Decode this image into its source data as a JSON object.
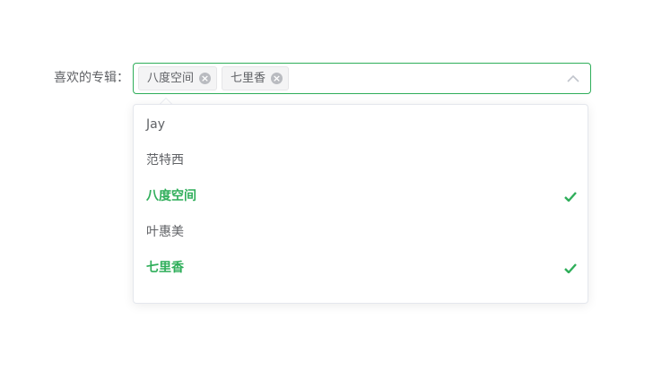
{
  "form": {
    "label": "喜欢的专辑："
  },
  "select": {
    "tags": [
      {
        "label": "八度空间"
      },
      {
        "label": "七里香"
      }
    ],
    "accent_color": "#2fae5a"
  },
  "dropdown": {
    "options": [
      {
        "label": "Jay",
        "selected": false
      },
      {
        "label": "范特西",
        "selected": false
      },
      {
        "label": "八度空间",
        "selected": true
      },
      {
        "label": "叶惠美",
        "selected": false
      },
      {
        "label": "七里香",
        "selected": true
      },
      {
        "label": "...",
        "selected": false
      }
    ]
  },
  "icons": {
    "tag_close": "circle-x-icon",
    "select_arrow": "chevron-up-icon",
    "selected_mark": "check-icon"
  }
}
